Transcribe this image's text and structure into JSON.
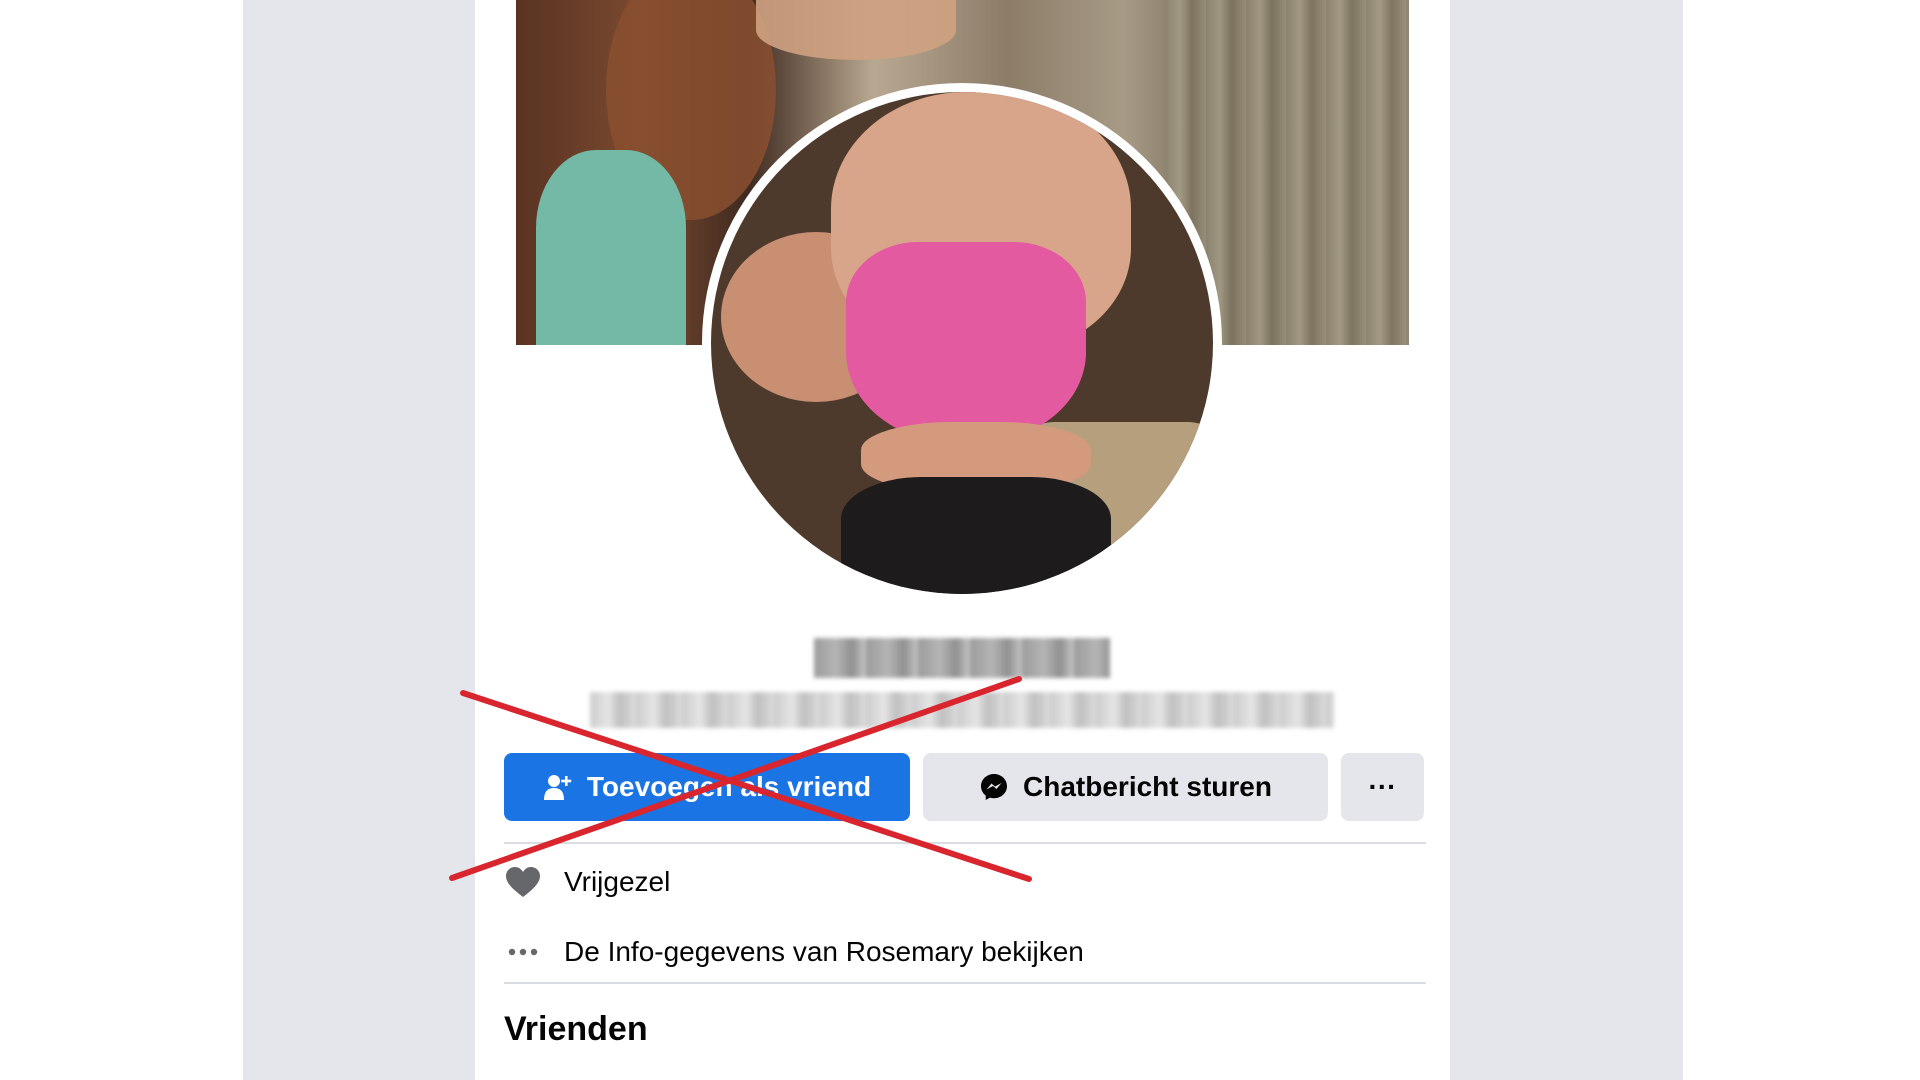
{
  "profile": {
    "buttons": {
      "add_friend_label": "Toevoegen als vriend",
      "message_label": "Chatbericht sturen",
      "more_label": "···"
    },
    "intro": {
      "relationship_status": "Vrijgezel",
      "view_info_link": "De Info-gegevens van Rosemary bekijken"
    },
    "friends_section_title": "Vrienden"
  },
  "colors": {
    "primary_button": "#1b74e4",
    "secondary_button": "#e4e6eb",
    "annotation_cross": "#d9262e"
  },
  "icons": {
    "add_friend": "add-friend-icon",
    "messenger": "messenger-icon",
    "more": "more-icon",
    "relationship": "heart-icon",
    "info": "ellipsis-icon"
  }
}
